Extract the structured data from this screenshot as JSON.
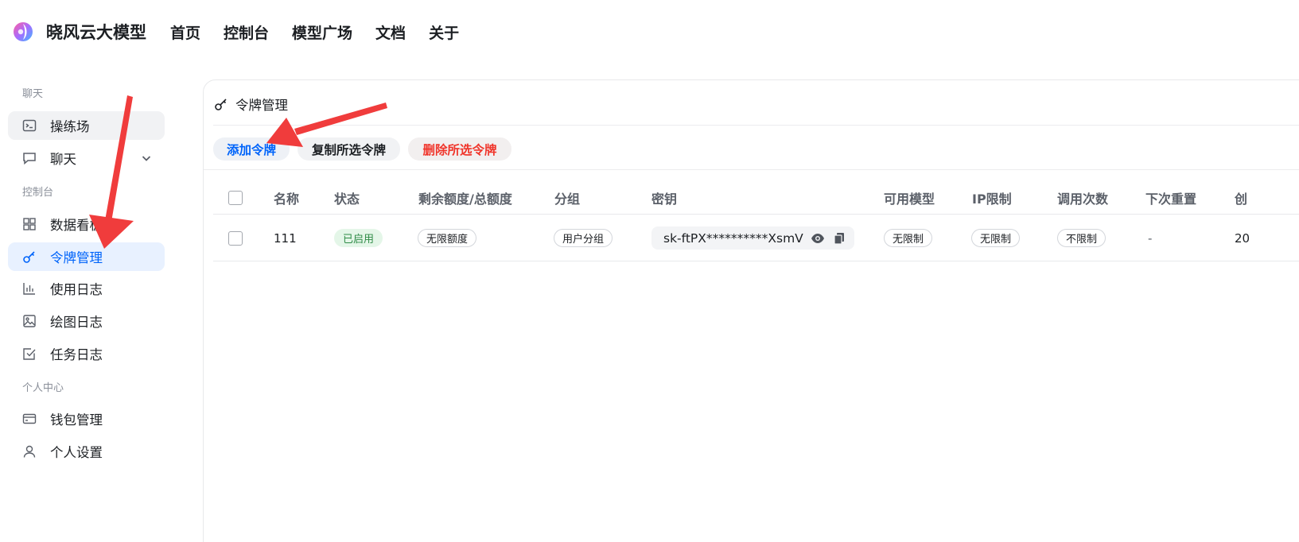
{
  "header": {
    "brand": "晓风云大模型",
    "nav": [
      "首页",
      "控制台",
      "模型广场",
      "文档",
      "关于"
    ]
  },
  "sidebar": {
    "sections": [
      "聊天",
      "控制台",
      "个人中心"
    ],
    "items": [
      {
        "label": "操练场",
        "icon": "terminal-icon"
      },
      {
        "label": "聊天",
        "icon": "chat-bubble-icon"
      },
      {
        "label": "数据看板",
        "icon": "dashboard-icon"
      },
      {
        "label": "令牌管理",
        "icon": "key-icon"
      },
      {
        "label": "使用日志",
        "icon": "bar-chart-icon"
      },
      {
        "label": "绘图日志",
        "icon": "image-icon"
      },
      {
        "label": "任务日志",
        "icon": "checkbox-icon"
      },
      {
        "label": "钱包管理",
        "icon": "wallet-icon"
      },
      {
        "label": "个人设置",
        "icon": "user-icon"
      }
    ],
    "active": "令牌管理"
  },
  "panel": {
    "title": "令牌管理",
    "buttons": {
      "add": "添加令牌",
      "copy": "复制所选令牌",
      "delete": "删除所选令牌"
    }
  },
  "table": {
    "columns": [
      "名称",
      "状态",
      "剩余额度/总额度",
      "分组",
      "密钥",
      "可用模型",
      "IP限制",
      "调用次数",
      "下次重置",
      "创"
    ],
    "rows": [
      {
        "name": "111",
        "status": "已启用",
        "quota": "无限额度",
        "group": "用户分组",
        "key": "sk-ftPX**********XsmV",
        "models": "无限制",
        "ip": "无限制",
        "calls": "不限制",
        "next_reset": "-",
        "created": "20"
      }
    ]
  },
  "colors": {
    "accent": "#0064fa",
    "danger": "#f0352b",
    "success": "#2e8b46",
    "annotation_arrow": "#f03c3c"
  }
}
